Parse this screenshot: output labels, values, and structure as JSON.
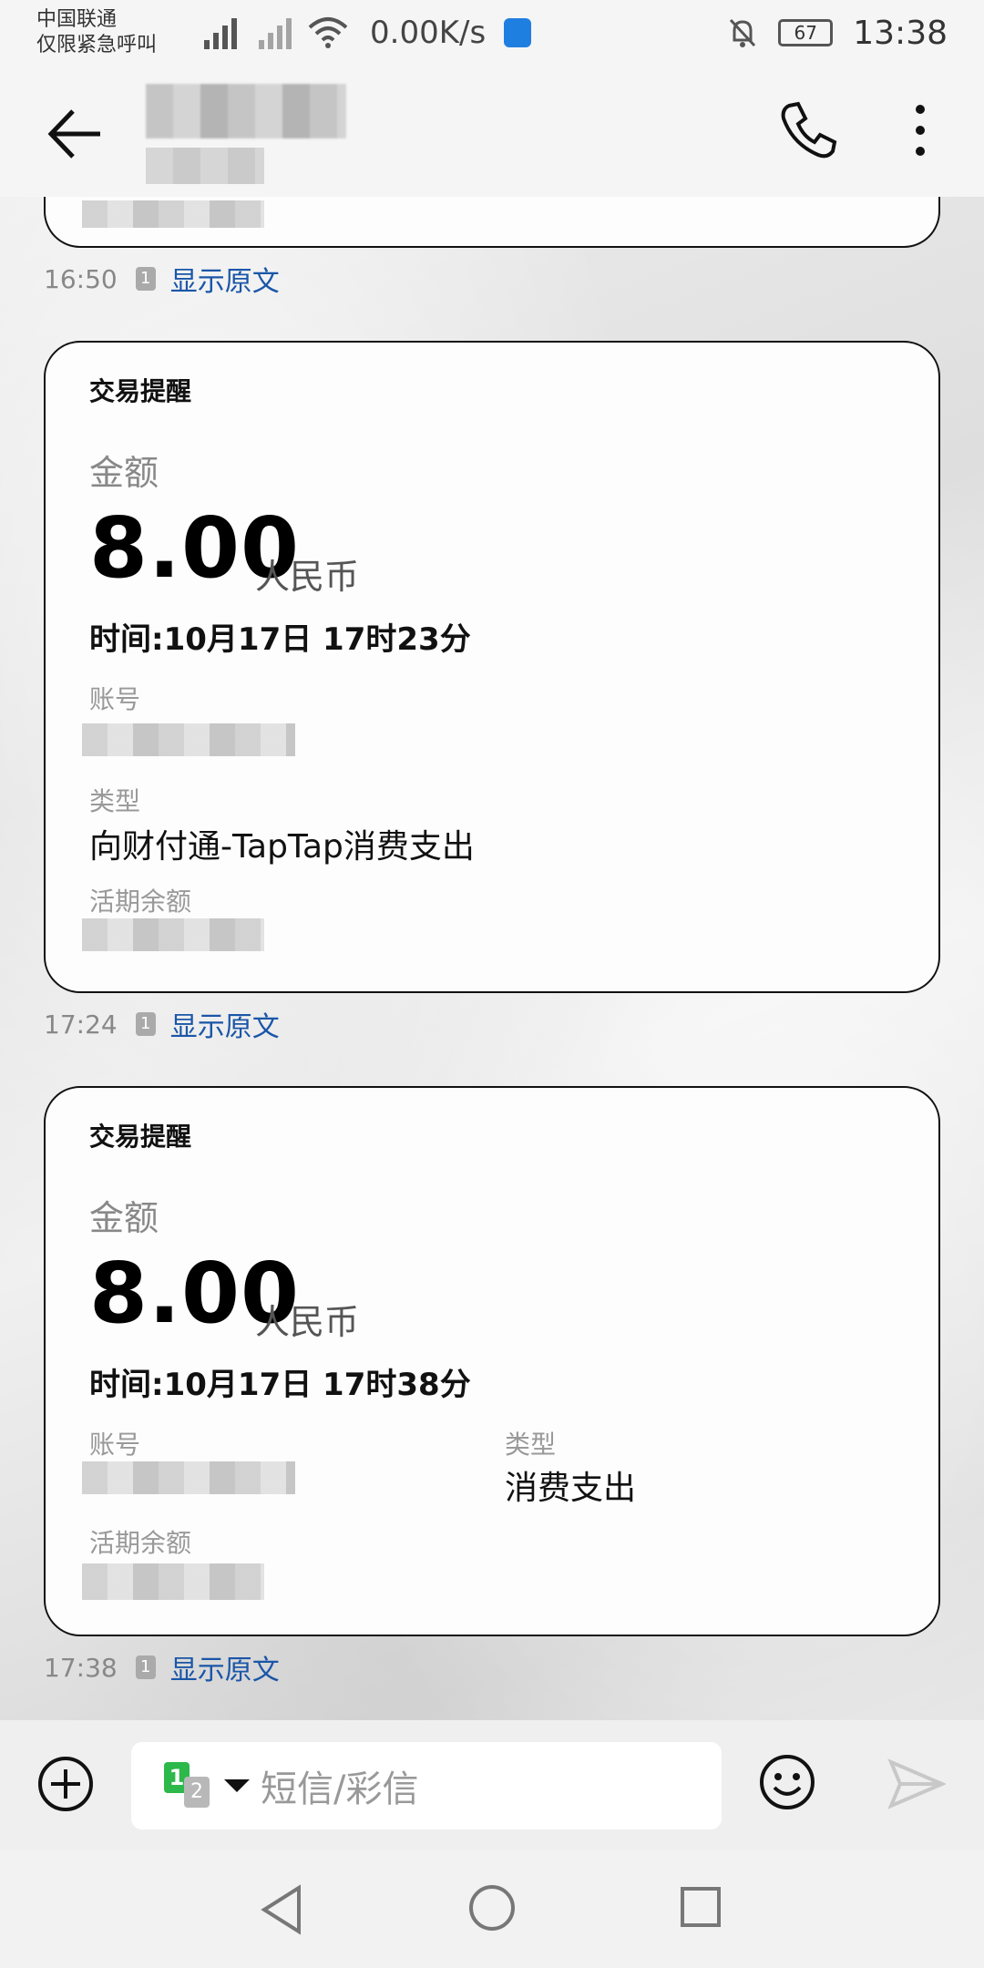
{
  "status_bar": {
    "carrier_line1": "中国联通",
    "carrier_line2": "仅限紧急呼叫",
    "network": "4G",
    "speed": "0.00K/s",
    "battery": "67",
    "time": "13:38"
  },
  "header": {
    "back_icon": "arrow-left-icon",
    "call_icon": "phone-icon",
    "more_icon": "more-vertical-icon"
  },
  "messages": [
    {
      "timestamp": "16:50",
      "show_original": "显示原文"
    },
    {
      "title": "交易提醒",
      "amount_label": "金额",
      "amount": "8.00",
      "currency": "人民币",
      "time": "时间:10月17日 17时23分",
      "account_label": "账号",
      "type_label": "类型",
      "type_value": "向财付通-TapTap消费支出",
      "balance_label": "活期余额",
      "timestamp": "17:24",
      "show_original": "显示原文"
    },
    {
      "title": "交易提醒",
      "amount_label": "金额",
      "amount": "8.00",
      "currency": "人民币",
      "time": "时间:10月17日 17时38分",
      "account_label": "账号",
      "type_label": "类型",
      "type_value": "消费支出",
      "balance_label": "活期余额",
      "timestamp": "17:38",
      "show_original": "显示原文"
    }
  ],
  "input_bar": {
    "sim_primary": "1",
    "sim_secondary": "2",
    "placeholder": "短信/彩信"
  },
  "colors": {
    "link": "#1a56a8",
    "sim1": "#2db84a"
  }
}
